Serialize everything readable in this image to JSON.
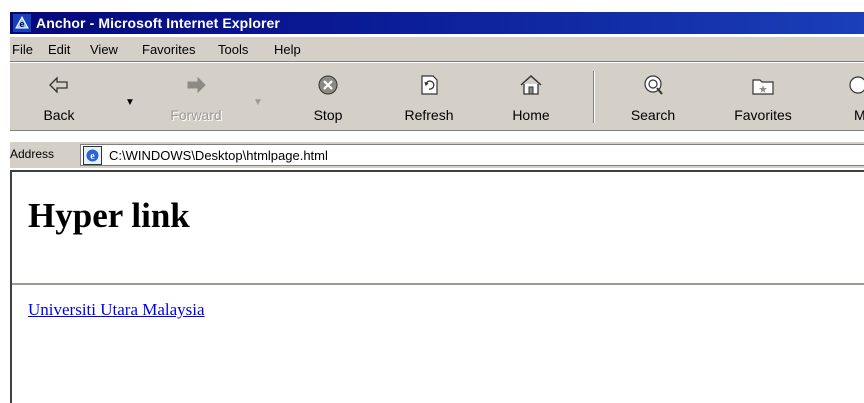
{
  "window": {
    "title": "Anchor - Microsoft Internet Explorer"
  },
  "menu": [
    {
      "label": "File"
    },
    {
      "label": "Edit"
    },
    {
      "label": "View"
    },
    {
      "label": "Favorites"
    },
    {
      "label": "Tools"
    },
    {
      "label": "Help"
    }
  ],
  "toolbar": {
    "back": "Back",
    "forward": "Forward",
    "stop": "Stop",
    "refresh": "Refresh",
    "home": "Home",
    "search": "Search",
    "favorites": "Favorites",
    "more": "M"
  },
  "address": {
    "label": "Address",
    "url": "C:\\WINDOWS\\Desktop\\htmlpage.html"
  },
  "page": {
    "heading": "Hyper link",
    "link_text": "Universiti Utara Malaysia"
  },
  "colors": {
    "titlebar": "#05087a",
    "chrome": "#d4d0c8",
    "link": "#0000ee"
  }
}
